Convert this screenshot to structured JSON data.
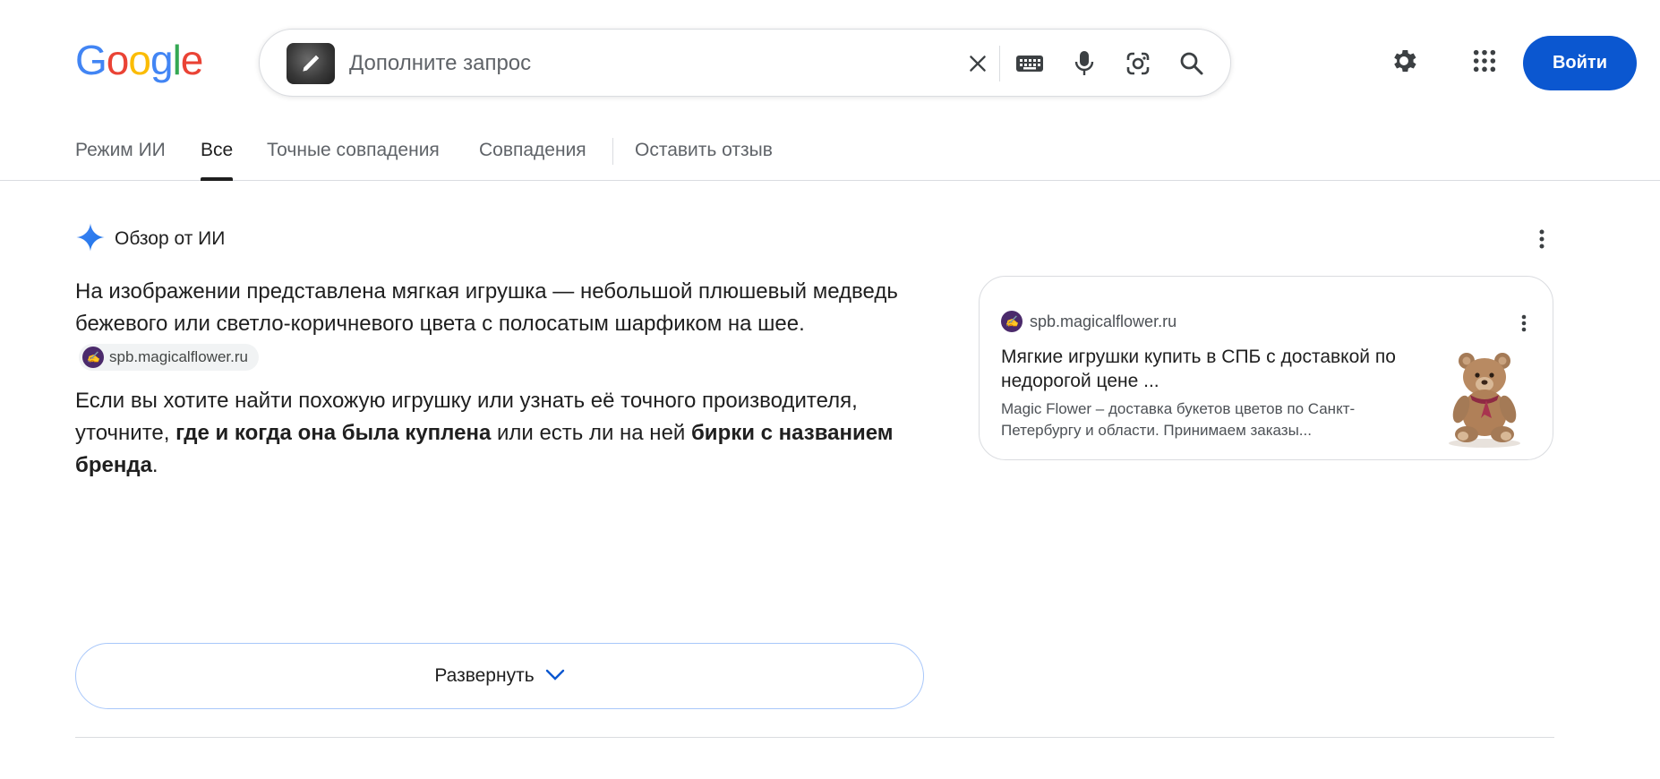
{
  "logo": {
    "letters": [
      "G",
      "o",
      "o",
      "g",
      "l",
      "e"
    ],
    "colors": [
      "#4285f4",
      "#ea4335",
      "#fbbc05",
      "#4285f4",
      "#34a853",
      "#ea4335"
    ]
  },
  "search": {
    "placeholder": "Дополните запрос",
    "value": "",
    "icons": [
      "image-thumbnail-edit-icon",
      "clear-icon",
      "keyboard-icon",
      "microphone-icon",
      "google-lens-icon",
      "search-icon"
    ]
  },
  "header": {
    "settings_icon": "gear-icon",
    "apps_icon": "apps-grid-icon",
    "signin_label": "Войти",
    "accent": "#0b57d0"
  },
  "tabs": [
    {
      "label": "Режим ИИ",
      "active": false
    },
    {
      "label": "Все",
      "active": true
    },
    {
      "label": "Точные совпадения",
      "active": false
    },
    {
      "label": "Совпадения",
      "active": false
    },
    {
      "label": "Оставить отзыв",
      "active": false
    }
  ],
  "ai_overview": {
    "heading": "Обзор от ИИ",
    "icon": "gemini-sparkle-icon",
    "para1": "На изображении представлена мягкая игрушка — небольшой плюшевый медведь бежевого или светло-коричневого цвета с полосатым шарфиком на шее.",
    "chip_label": "spb.magicalflower.ru",
    "para2_a": "Если вы хотите найти похожую игрушку или узнать её точного производителя, уточните, ",
    "para2_b": "где и когда она была куплена",
    "para2_c": " или есть ли на ней ",
    "para2_d": "бирки с названием бренда",
    "para2_e": ".",
    "expand_label": "Развернуть"
  },
  "source_card": {
    "site": "spb.magicalflower.ru",
    "title": "Мягкие игрушки купить в СПБ с доставкой по недорогой цене ...",
    "snippet": "Magic Flower – доставка букетов цветов по Санкт-Петербургу и области. Принимаем заказы..."
  }
}
